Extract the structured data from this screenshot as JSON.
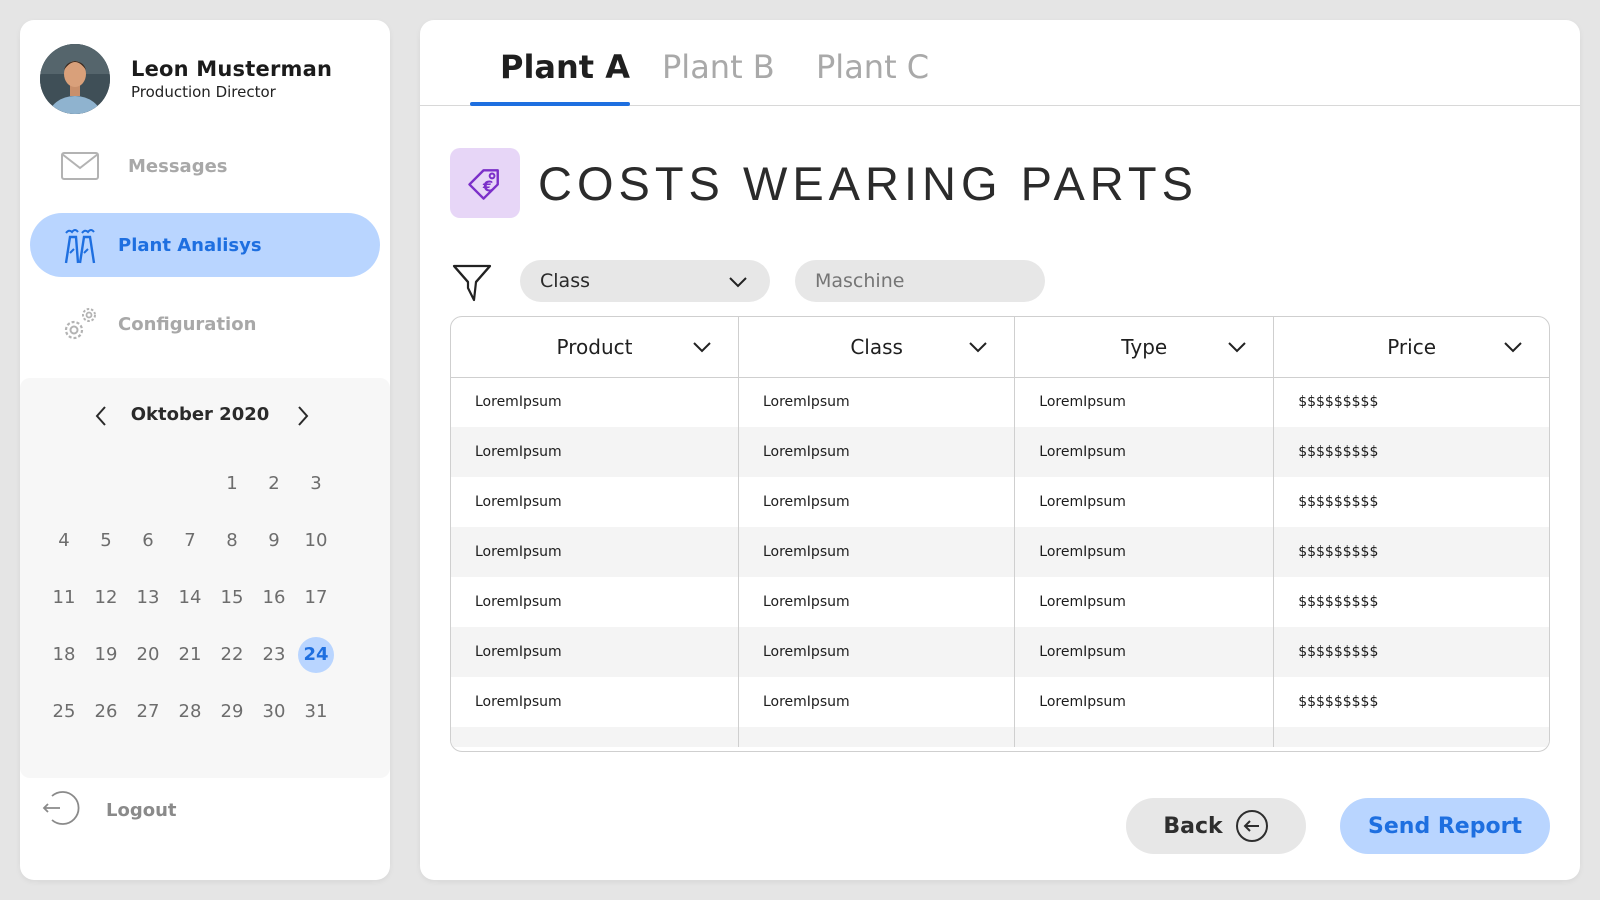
{
  "user": {
    "name": "Leon Musterman",
    "role": "Production Director"
  },
  "nav": {
    "messages": "Messages",
    "plant_analysis": "Plant Analisys",
    "configuration": "Configuration",
    "logout": "Logout"
  },
  "calendar": {
    "month": "Oktober 2020",
    "selected_day": 24,
    "weeks": [
      [
        "",
        "",
        "",
        "",
        "1",
        "2",
        "3"
      ],
      [
        "4",
        "5",
        "6",
        "7",
        "8",
        "9",
        "10"
      ],
      [
        "11",
        "12",
        "13",
        "14",
        "15",
        "16",
        "17"
      ],
      [
        "18",
        "19",
        "20",
        "21",
        "22",
        "23",
        "24"
      ],
      [
        "25",
        "26",
        "27",
        "28",
        "29",
        "30",
        "31"
      ]
    ]
  },
  "tabs": [
    "Plant A",
    "Plant B",
    "Plant C"
  ],
  "active_tab": 0,
  "page": {
    "title": "COSTS WEARING PARTS"
  },
  "filters": {
    "class_label": "Class",
    "machine_placeholder": "Maschine"
  },
  "table": {
    "headers": [
      "Product",
      "Class",
      "Type",
      "Price"
    ],
    "rows": [
      [
        "LoremIpsum",
        "LoremIpsum",
        "LoremIpsum",
        "$$$$$$$$$"
      ],
      [
        "LoremIpsum",
        "LoremIpsum",
        "LoremIpsum",
        "$$$$$$$$$"
      ],
      [
        "LoremIpsum",
        "LoremIpsum",
        "LoremIpsum",
        "$$$$$$$$$"
      ],
      [
        "LoremIpsum",
        "LoremIpsum",
        "LoremIpsum",
        "$$$$$$$$$"
      ],
      [
        "LoremIpsum",
        "LoremIpsum",
        "LoremIpsum",
        "$$$$$$$$$"
      ],
      [
        "LoremIpsum",
        "LoremIpsum",
        "LoremIpsum",
        "$$$$$$$$$"
      ],
      [
        "LoremIpsum",
        "LoremIpsum",
        "LoremIpsum",
        "$$$$$$$$$"
      ]
    ]
  },
  "buttons": {
    "back": "Back",
    "send_report": "Send Report"
  },
  "colors": {
    "accent": "#1e6fe0",
    "accent_light": "#b9d5ff",
    "tag_bg": "#e7d6f7",
    "tag_stroke": "#7b2fc9"
  },
  "icons": [
    "mail-icon",
    "factory-icon",
    "gears-icon",
    "calendar-prev-icon",
    "calendar-next-icon",
    "logout-icon",
    "price-tag-euro-icon",
    "filter-icon",
    "chevron-down-icon",
    "arrow-left-circle-icon"
  ]
}
